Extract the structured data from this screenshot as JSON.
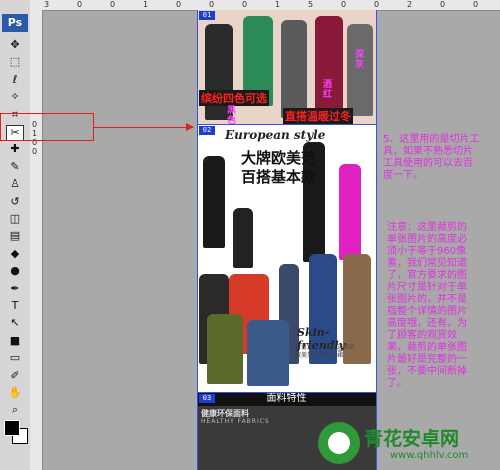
{
  "app": {
    "logo": "Ps"
  },
  "toolbar": {
    "tools": [
      {
        "name": "move-tool",
        "glyph": "✥"
      },
      {
        "name": "marquee-tool",
        "glyph": "⬚"
      },
      {
        "name": "lasso-tool",
        "glyph": "ℓ"
      },
      {
        "name": "quick-select-tool",
        "glyph": "✧"
      },
      {
        "name": "crop-tool",
        "glyph": "⌗"
      },
      {
        "name": "slice-tool",
        "glyph": "✂",
        "selected": true
      },
      {
        "name": "healing-tool",
        "glyph": "✚"
      },
      {
        "name": "brush-tool",
        "glyph": "✎"
      },
      {
        "name": "stamp-tool",
        "glyph": "♙"
      },
      {
        "name": "history-brush-tool",
        "glyph": "↺"
      },
      {
        "name": "eraser-tool",
        "glyph": "◫"
      },
      {
        "name": "gradient-tool",
        "glyph": "▤"
      },
      {
        "name": "blur-tool",
        "glyph": "◆"
      },
      {
        "name": "dodge-tool",
        "glyph": "●"
      },
      {
        "name": "pen-tool",
        "glyph": "✒"
      },
      {
        "name": "type-tool",
        "glyph": "T"
      },
      {
        "name": "path-select-tool",
        "glyph": "↖"
      },
      {
        "name": "shape-tool",
        "glyph": "■"
      },
      {
        "name": "notes-tool",
        "glyph": "▭"
      },
      {
        "name": "eyedropper-tool",
        "glyph": "✐"
      },
      {
        "name": "hand-tool",
        "glyph": "✋"
      },
      {
        "name": "zoom-tool",
        "glyph": "⌕"
      }
    ]
  },
  "rulers": {
    "top_labels": [
      "3",
      "0",
      "0",
      "1",
      "0",
      "0",
      "0",
      "1",
      "5",
      "0",
      "0",
      "2",
      "0",
      "0"
    ],
    "left_labels": [
      "0",
      "1",
      "0",
      "0"
    ]
  },
  "document": {
    "slices": [
      "01",
      "02",
      "03"
    ],
    "section1": {
      "label1": "缤纷四色可选",
      "label2": "直搭温暖过冬",
      "color_black": "黑色",
      "color_wine": "酒红",
      "color_deep": "深灰"
    },
    "section2": {
      "european": "European style",
      "headline1": "大牌欧美范",
      "headline2": "百搭基本款",
      "skin": "Skin-friendly",
      "caption": "百分之一，就是这样的",
      "caption2": "欧美范风格的长裙"
    },
    "section3": {
      "bar": "面料特性",
      "fabric_cn": "健康环保面料",
      "fabric_en": "HEALTHY FABRICS"
    }
  },
  "annotations": {
    "note1": [
      "5、这里用的是切片工",
      "具，如果不熟悉切片",
      "工具使用的可以去百",
      "度一下。"
    ],
    "note2": [
      "注意：这里裁剪的",
      "单张图片的高度必",
      "须小于等于960像",
      "素，我们常见知道",
      "了，官方要求的图",
      "片尺寸是针对于单",
      "张图片的，并不是",
      "指整个详情的图片",
      "高度哦，还有，为",
      "了顾客的观赏效",
      "果，裁剪的单张图",
      "片最好是完整的一",
      "张，不要中间断掉",
      "了。"
    ]
  },
  "watermark": {
    "title": "青花安卓网",
    "url": "www.qhhlv.com"
  },
  "colors": {
    "annotation": "#e030e0",
    "arrow": "#e02020",
    "slice_tag": "#1e3fc9",
    "watermark": "#1e8a2c"
  }
}
